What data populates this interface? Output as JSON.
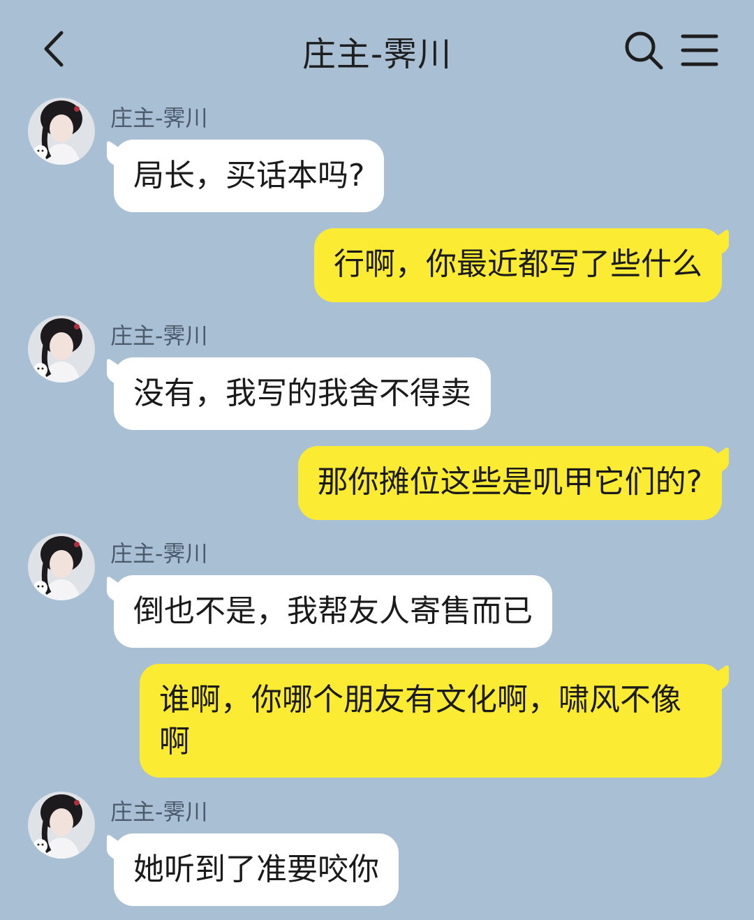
{
  "header": {
    "title": "庄主-霁川",
    "back_icon": "chevron-left-icon",
    "search_icon": "search-icon",
    "menu_icon": "menu-icon"
  },
  "colors": {
    "background": "#a9bfd4",
    "incoming_bubble": "#ffffff",
    "outgoing_bubble": "#fbeb33"
  },
  "messages": [
    {
      "direction": "in",
      "sender": "庄主-霁川",
      "text": "局长，买话本吗?"
    },
    {
      "direction": "out",
      "text": "行啊，你最近都写了些什么"
    },
    {
      "direction": "in",
      "sender": "庄主-霁川",
      "text": "没有，我写的我舍不得卖"
    },
    {
      "direction": "out",
      "text": "那你摊位这些是叽甲它们的?"
    },
    {
      "direction": "in",
      "sender": "庄主-霁川",
      "text": "倒也不是，我帮友人寄售而已"
    },
    {
      "direction": "out",
      "text": "谁啊，你哪个朋友有文化啊，啸风不像啊"
    },
    {
      "direction": "in",
      "sender": "庄主-霁川",
      "text": "她听到了准要咬你"
    }
  ]
}
